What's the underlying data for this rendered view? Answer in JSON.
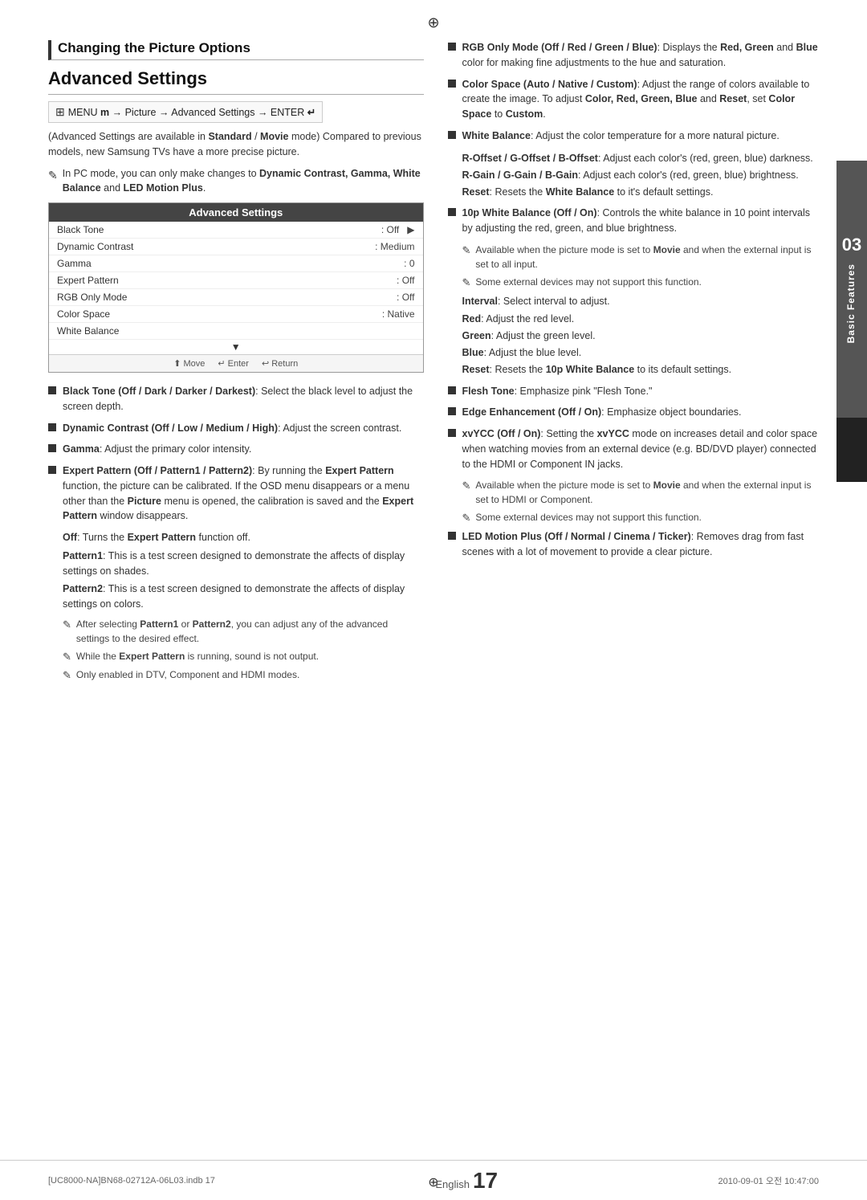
{
  "page": {
    "top_compass": "⊕",
    "bottom_compass": "⊕"
  },
  "side_tab": {
    "number": "03",
    "text": "Basic Features"
  },
  "left_col": {
    "section_heading": "Changing the Picture Options",
    "subsection_title": "Advanced Settings",
    "menu_nav": "MENU  → Picture → Advanced Settings → ENTER",
    "intro_text": "(Advanced Settings are available in Standard / Movie mode) Compared to previous models, new Samsung TVs have a more precise picture.",
    "note_pc_mode": "In PC mode, you can only make changes to Dynamic Contrast, Gamma, White Balance and LED Motion Plus.",
    "table": {
      "title": "Advanced Settings",
      "rows": [
        {
          "label": "Black Tone",
          "value": ": Off",
          "arrow": "▶"
        },
        {
          "label": "Dynamic Contrast",
          "value": ": Medium",
          "arrow": ""
        },
        {
          "label": "Gamma",
          "value": ": 0",
          "arrow": ""
        },
        {
          "label": "Expert Pattern",
          "value": ": Off",
          "arrow": ""
        },
        {
          "label": "RGB Only Mode",
          "value": ": Off",
          "arrow": ""
        },
        {
          "label": "Color Space",
          "value": ": Native",
          "arrow": ""
        },
        {
          "label": "White Balance",
          "value": "",
          "arrow": ""
        }
      ],
      "down_arrow": "▼",
      "footer_items": [
        "⬆ Move",
        "↵ Enter",
        "↩ Return"
      ]
    },
    "bullets": [
      {
        "title": "Black Tone (Off / Dark / Darker / Darkest)",
        "text": ": Select the black level to adjust the screen depth."
      },
      {
        "title": "Dynamic Contrast (Off / Low / Medium / High)",
        "text": ": Adjust the screen contrast."
      },
      {
        "title": "Gamma",
        "text": ": Adjust the primary color intensity."
      },
      {
        "title": "Expert Pattern (Off / Pattern1 / Pattern2)",
        "text": ": By running the Expert Pattern function, the picture can be calibrated. If the OSD menu disappears or a menu other than the Picture menu is opened, the calibration is saved and the Expert Pattern window disappears."
      }
    ],
    "expert_subs": [
      "Off: Turns the Expert Pattern function off.",
      "Pattern1: This is a test screen designed to demonstrate the affects of display settings on shades.",
      "Pattern2: This is a test screen designed to demonstrate the affects of display settings on colors."
    ],
    "expert_notes": [
      "After selecting Pattern1 or Pattern2, you can adjust any of the advanced settings to the desired effect.",
      "While the Expert Pattern is running, sound is not output.",
      "Only enabled in DTV, Component and HDMI modes."
    ]
  },
  "right_col": {
    "bullets": [
      {
        "title": "RGB Only Mode (Off / Red / Green / Blue)",
        "text": ": Displays the Red, Green and Blue color for making fine adjustments to the hue and saturation."
      },
      {
        "title": "Color Space (Auto / Native / Custom)",
        "text": ": Adjust the range of colors available to create the image. To adjust Color, Red, Green, Blue and Reset, set Color Space to Custom."
      },
      {
        "title": "White Balance",
        "text": ": Adjust the color temperature for a more natural picture."
      }
    ],
    "white_balance_details": [
      "R-Offset / G-Offset / B-Offset: Adjust each color's (red, green, blue) darkness.",
      "R-Gain / G-Gain / B-Gain: Adjust each color's (red, green, blue) brightness.",
      "Reset: Resets the White Balance to it's default settings."
    ],
    "bullets2": [
      {
        "title": "10p White Balance (Off / On)",
        "text": ": Controls the white balance in 10 point intervals by adjusting the red, green, and blue brightness."
      }
    ],
    "ten_p_notes": [
      "Available when the picture mode is set to Movie and when the external input is set to all input.",
      "Some external devices may not support this function."
    ],
    "ten_p_details": [
      "Interval: Select interval to adjust.",
      "Red: Adjust the red level.",
      "Green: Adjust the green level.",
      "Blue: Adjust the blue level.",
      "Reset: Resets the 10p White Balance to its default settings."
    ],
    "bullets3": [
      {
        "title": "Flesh Tone",
        "text": ": Emphasize pink \"Flesh Tone.\""
      },
      {
        "title": "Edge Enhancement (Off / On)",
        "text": ": Emphasize object boundaries."
      },
      {
        "title": "xvYCC (Off / On)",
        "text": ": Setting the xvYCC mode on increases detail and color space when watching movies from an external device (e.g. BD/DVD player) connected to the HDMI or Component IN jacks."
      }
    ],
    "xvycc_notes": [
      "Available when the picture mode is set to Movie and when the external input is set to HDMI or Component.",
      "Some external devices may not support this function."
    ],
    "bullets4": [
      {
        "title": "LED Motion Plus (Off / Normal / Cinema / Ticker)",
        "text": ": Removes drag from fast scenes with a lot of movement to provide a clear picture."
      }
    ]
  },
  "footer": {
    "left_text": "[UC8000-NA]BN68-02712A-06L03.indb  17",
    "right_text": "2010-09-01  오전 10:47:00",
    "page_label": "English",
    "page_number": "17"
  }
}
